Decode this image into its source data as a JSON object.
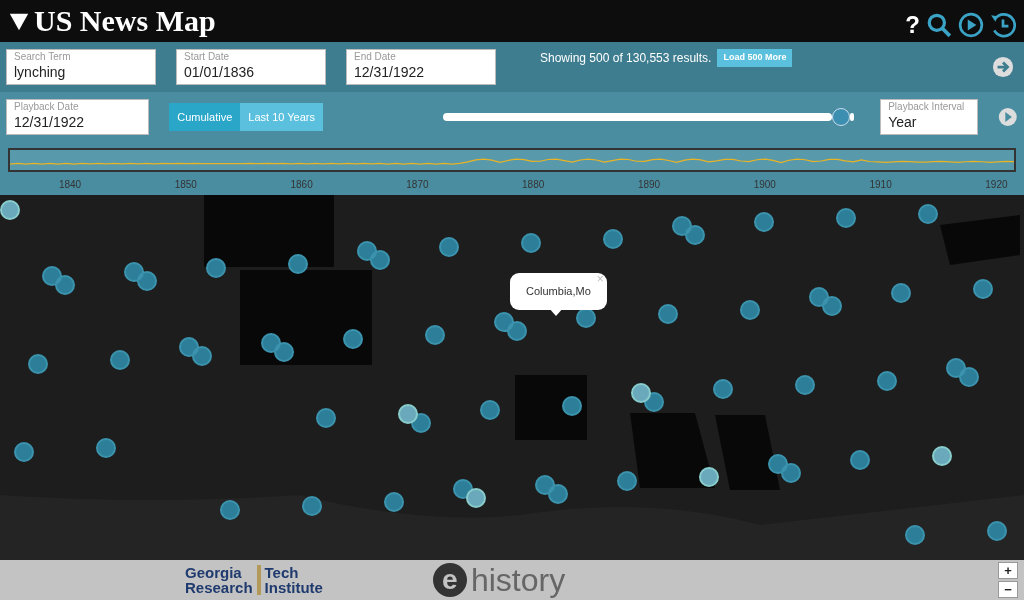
{
  "header": {
    "title": "US News Map",
    "help": "?"
  },
  "search": {
    "fields": [
      {
        "label": "Search Term",
        "value": "lynching"
      },
      {
        "label": "Start Date",
        "value": "01/01/1836"
      },
      {
        "label": "End Date",
        "value": "12/31/1922"
      }
    ],
    "results": "Showing 500 of 130,553 results.",
    "load_button": "Load 500 More"
  },
  "playback": {
    "date": {
      "label": "Playback Date",
      "value": "12/31/1922"
    },
    "modes": [
      {
        "label": "Cumulative",
        "selected": true
      },
      {
        "label": "Last 10 Years",
        "selected": false
      }
    ],
    "slider": {
      "level": 0.99
    },
    "interval": {
      "label": "Playback Interval",
      "value": "Year"
    }
  },
  "timeline": {
    "years": [
      "1840",
      "1850",
      "1860",
      "1870",
      "1880",
      "1890",
      "1900",
      "1910",
      "1920"
    ]
  },
  "map": {
    "popup": {
      "text": "Columbia,Mo",
      "close": "×"
    }
  },
  "footer": {
    "logos": [
      {
        "kind": "gtri",
        "lines": [
          "Georgia",
          "Research",
          "Tech",
          "Institute"
        ]
      },
      {
        "kind": "ehistory",
        "mark": "e",
        "word": "history"
      }
    ],
    "zoom": [
      "+",
      "−"
    ]
  }
}
